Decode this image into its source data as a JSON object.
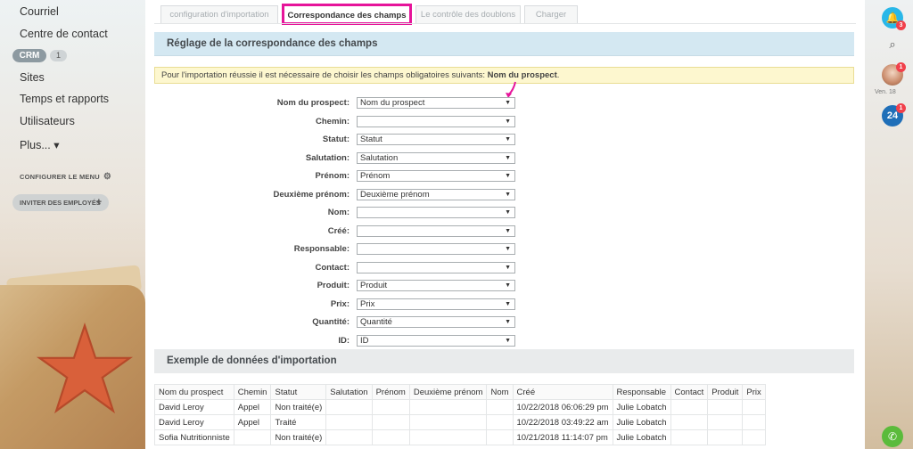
{
  "sidebar": {
    "items": [
      {
        "label": "Courriel"
      },
      {
        "label": "Centre de contact"
      },
      {
        "label": "Sites"
      },
      {
        "label": "Temps et rapports"
      },
      {
        "label": "Utilisateurs"
      },
      {
        "label": "Plus... ▾"
      }
    ],
    "crm_label": "CRM",
    "crm_count": "1",
    "configure_menu": "CONFIGURER LE MENU",
    "invite_employees": "INVITER DES EMPLOYÉS"
  },
  "tabs": [
    {
      "label": "configuration d'importation",
      "active": false
    },
    {
      "label": "Correspondance des champs",
      "active": true
    },
    {
      "label": "Le contrôle des doublons",
      "active": false
    },
    {
      "label": "Charger",
      "active": false
    }
  ],
  "mapping": {
    "title": "Réglage de la correspondance des champs",
    "notice_text": "Pour l'importation réussie il est nécessaire de choisir les champs obligatoires suivants: ",
    "notice_required": "Nom du prospect",
    "notice_suffix": ".",
    "fields": [
      {
        "label": "Nom du prospect:",
        "value": "Nom du prospect"
      },
      {
        "label": "Chemin:",
        "value": ""
      },
      {
        "label": "Statut:",
        "value": "Statut"
      },
      {
        "label": "Salutation:",
        "value": "Salutation"
      },
      {
        "label": "Prénom:",
        "value": "Prénom"
      },
      {
        "label": "Deuxième prénom:",
        "value": "Deuxième prénom"
      },
      {
        "label": "Nom:",
        "value": ""
      },
      {
        "label": "Créé:",
        "value": ""
      },
      {
        "label": "Responsable:",
        "value": ""
      },
      {
        "label": "Contact:",
        "value": ""
      },
      {
        "label": "Produit:",
        "value": "Produit"
      },
      {
        "label": "Prix:",
        "value": "Prix"
      },
      {
        "label": "Quantité:",
        "value": "Quantité"
      },
      {
        "label": "ID:",
        "value": "ID"
      }
    ]
  },
  "sample": {
    "title": "Exemple de données d'importation",
    "columns": [
      "Nom du prospect",
      "Chemin",
      "Statut",
      "Salutation",
      "Prénom",
      "Deuxième prénom",
      "Nom",
      "Créé",
      "Responsable",
      "Contact",
      "Produit",
      "Prix"
    ],
    "rows": [
      [
        "David Leroy",
        "Appel",
        "Non traité(e)",
        "",
        "",
        "",
        "",
        "10/22/2018 06:06:29 pm",
        "Julie Lobatch",
        "",
        "",
        ""
      ],
      [
        "David Leroy",
        "Appel",
        "Traité",
        "",
        "",
        "",
        "",
        "10/22/2018 03:49:22 am",
        "Julie Lobatch",
        "",
        "",
        ""
      ],
      [
        "Sofia Nutritionniste",
        "",
        "Non traité(e)",
        "",
        "",
        "",
        "",
        "10/21/2018 11:14:07 pm",
        "Julie Lobatch",
        "",
        "",
        ""
      ]
    ]
  },
  "rail": {
    "bell_badge": "3",
    "avatar_badge": "1",
    "date_label": "Ven. 18",
    "b24_label": "24",
    "b24_badge": "1"
  }
}
